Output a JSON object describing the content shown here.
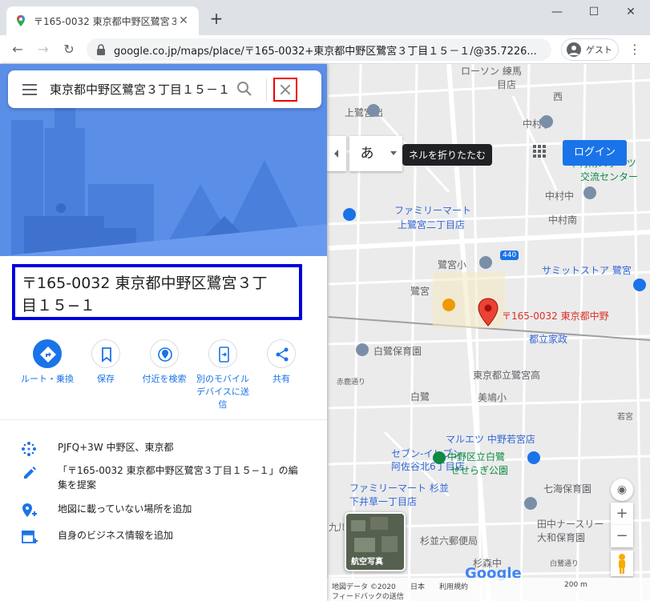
{
  "browser": {
    "tab_title": "〒165-0032 東京都中野区鷺宮３",
    "url": "google.co.jp/maps/place/〒165-0032+東京都中野区鷺宮３丁目１５－１/@35.7226...",
    "profile_label": "ゲスト"
  },
  "search": {
    "value": "東京都中野区鷺宮３丁目１５－１"
  },
  "place": {
    "title_line1": "〒165-0032 東京都中野区鷺宮３丁",
    "title_line2": "目１５−１"
  },
  "actions": [
    {
      "label": "ルート・乗換",
      "icon": "directions-icon"
    },
    {
      "label": "保存",
      "icon": "bookmark-icon"
    },
    {
      "label": "付近を検索",
      "icon": "nearby-icon"
    },
    {
      "label": "別のモバイルデバイスに送信",
      "icon": "send-to-phone-icon"
    },
    {
      "label": "共有",
      "icon": "share-icon"
    }
  ],
  "info": {
    "plus_code": "PJFQ+3W 中野区、東京都",
    "suggest_edit": "「〒165-0032 東京都中野区鷺宮３丁目１５−１」の編集を提案",
    "add_missing": "地図に載っていない場所を追加",
    "add_business": "自身のビジネス情報を追加"
  },
  "map": {
    "ime_label": "あ",
    "tooltip": "ネルを折りたたむ",
    "login_label": "ログイン",
    "satellite_label": "航空写真",
    "footer_data": "地図データ ©2020",
    "footer_japan": "日本",
    "footer_terms": "利用規約",
    "footer_feedback": "フィードバックの送信",
    "footer_scale": "200 m",
    "google_logo": "Google",
    "labels": {
      "lawson": "ローソン 練馬",
      "shop_top": "目店",
      "kamisagi_ekimae": "上鷺宮出",
      "nakamura_sho": "中村小",
      "nakamura_sports": "中村南スポーツ",
      "kouryu_center": "交流センター",
      "nakamura_chu": "中村中",
      "nakamura_minami": "中村南",
      "familymart_kamisagi": "ファミリーマート",
      "kamisagi_2": "上鷺宮二丁目店",
      "sagimiya_sho": "鷺宮小",
      "route_440": "440",
      "summit": "サミットストア 鷺宮",
      "sagimiya": "鷺宮",
      "pin_label": "〒165-0032 東京都中野",
      "toritsu_kaseiso": "都立家政",
      "shirasagi_hoikuen": "白鷺保育園",
      "toritsu_sagimiya_ko": "東京都立鷺宮高",
      "shirasagi": "白鷺",
      "bizen_sho": "美鳩小",
      "maruetsu": "マルエツ 中野若宮店",
      "seven_eleven": "セブン-イレブン",
      "asagaya_kita": "阿佐谷北6丁目店",
      "shirasagi_park": "中野区立白鷺",
      "seseragi": "せせらぎ公園",
      "familymart_suginami": "ファミリーマート 杉並",
      "shimoida": "下井草一丁目店",
      "nanaumi": "七海保育園",
      "tanaka_nursery": "田中ナースリー",
      "yamato_hoikuen": "大和保育園",
      "post_office": "杉並六郵便局",
      "kyu": "九川",
      "suginami_mori": "杉森中",
      "akabori": "赤鹿通り",
      "shirasagi_dori": "白鷺通り",
      "wakamiya": "若宮",
      "nishi": "西"
    }
  }
}
